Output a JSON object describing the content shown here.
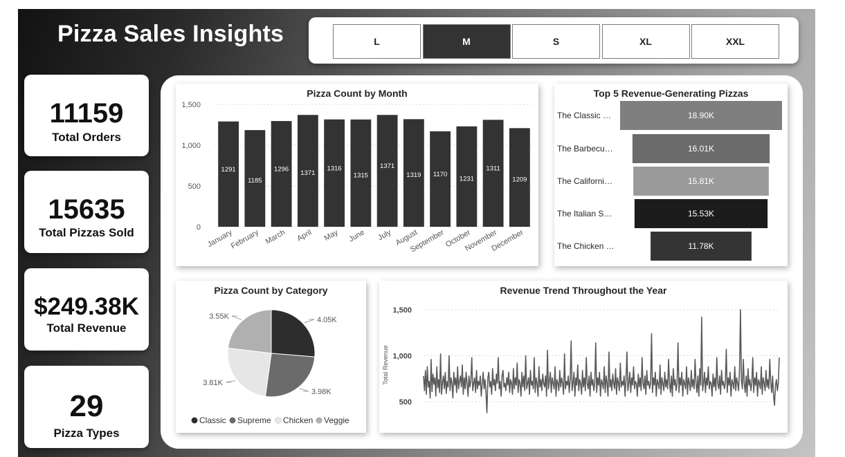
{
  "title": "Pizza Sales Insights",
  "size_filter": {
    "options": [
      "L",
      "M",
      "S",
      "XL",
      "XXL"
    ],
    "selected": "M"
  },
  "kpis": [
    {
      "value": "11159",
      "label": "Total Orders"
    },
    {
      "value": "15635",
      "label": "Total Pizzas Sold"
    },
    {
      "value": "$249.38K",
      "label": "Total Revenue"
    },
    {
      "value": "29",
      "label": "Pizza Types"
    }
  ],
  "colors": {
    "bar": "#333333",
    "top5": [
      "#7f7f7f",
      "#6b6b6b",
      "#9a9a9a",
      "#1c1c1c",
      "#343434"
    ],
    "pie": [
      "#2d2d2d",
      "#6b6b6b",
      "#e6e6e6",
      "#b0b0b0"
    ],
    "line": "#5a5a5a"
  },
  "chart_data": [
    {
      "type": "bar",
      "title": "Pizza Count by Month",
      "categories": [
        "January",
        "February",
        "March",
        "April",
        "May",
        "June",
        "July",
        "August",
        "September",
        "October",
        "November",
        "December"
      ],
      "values": [
        1291,
        1185,
        1296,
        1371,
        1316,
        1315,
        1371,
        1319,
        1170,
        1231,
        1311,
        1209
      ],
      "y_ticks": [
        "0",
        "500",
        "1,000",
        "1,500"
      ],
      "ylim": [
        0,
        1500
      ],
      "grid": true
    },
    {
      "type": "bar",
      "orientation": "horizontal-funnel",
      "title": "Top 5 Revenue-Generating Pizzas",
      "categories": [
        "The Classic …",
        "The Barbecu…",
        "The Californi…",
        "The Italian S…",
        "The Chicken …"
      ],
      "values": [
        18.9,
        16.01,
        15.81,
        15.53,
        11.78
      ],
      "value_labels": [
        "18.90K",
        "16.01K",
        "15.81K",
        "15.53K",
        "11.78K"
      ]
    },
    {
      "type": "pie",
      "title": "Pizza Count by Category",
      "categories": [
        "Classic",
        "Supreme",
        "Chicken",
        "Veggie"
      ],
      "values": [
        4.05,
        3.98,
        3.81,
        3.55
      ],
      "value_labels": [
        "4.05K",
        "3.98K",
        "3.81K",
        "3.55K"
      ],
      "legend": "bottom"
    },
    {
      "type": "line",
      "title": "Revenue Trend Throughout the Year",
      "ylabel": "Total Revenue",
      "y_ticks": [
        "500",
        "1,000",
        "1,500"
      ],
      "ylim": [
        400,
        1600
      ],
      "grid": true,
      "values": [
        780,
        620,
        840,
        580,
        880,
        660,
        720,
        540,
        960,
        610,
        800,
        690,
        760,
        560,
        880,
        650,
        740,
        600,
        1020,
        580,
        700,
        780,
        640,
        820,
        590,
        720,
        660,
        1000,
        620,
        760,
        700,
        540,
        820,
        680,
        760,
        600,
        880,
        640,
        720,
        780,
        660,
        900,
        580,
        760,
        640,
        820,
        700,
        560,
        780,
        660,
        720,
        980,
        620,
        700,
        760,
        600,
        840,
        640,
        720,
        680,
        780,
        560,
        700,
        820,
        640,
        740,
        600,
        380,
        760,
        820,
        660,
        720,
        580,
        860,
        680,
        740,
        620,
        800,
        700,
        980,
        640,
        720,
        560,
        780,
        840,
        660,
        700,
        620,
        760,
        680,
        820,
        600,
        740,
        700,
        580,
        860,
        640,
        760,
        680,
        920,
        600,
        740,
        700,
        560,
        820,
        660,
        780,
        620,
        1000,
        640,
        700,
        760,
        580,
        840,
        680,
        720,
        640,
        980,
        600,
        760,
        700,
        560,
        880,
        660,
        740,
        620,
        800,
        700,
        660,
        780,
        560,
        1060,
        640,
        720,
        820,
        600,
        760,
        700,
        640,
        880,
        560,
        740,
        700,
        620,
        840,
        660,
        760,
        700,
        580,
        1020,
        640,
        720,
        680,
        780,
        600,
        740,
        1160,
        620,
        700,
        820,
        560,
        760,
        680,
        900,
        620,
        740,
        700,
        580,
        840,
        660,
        760,
        620,
        980,
        700,
        640,
        780,
        560,
        820,
        680,
        740,
        620,
        700,
        1140,
        600,
        760,
        680,
        820,
        560,
        740,
        700,
        640,
        880,
        600,
        780,
        700,
        560,
        1040,
        660,
        740,
        620,
        800,
        700,
        640,
        860,
        580,
        760,
        700,
        620,
        920,
        660,
        720,
        680,
        780,
        560,
        740,
        1040,
        620,
        700,
        820,
        600,
        760,
        680,
        880,
        640,
        720,
        700,
        560,
        800,
        660,
        760,
        620,
        980,
        700,
        640,
        780,
        580,
        840,
        680,
        720,
        640,
        700,
        1240,
        600,
        760,
        680,
        820,
        560,
        740,
        700,
        640,
        900,
        580,
        760,
        700,
        620,
        820,
        660,
        740,
        640,
        960,
        700,
        600,
        780,
        560,
        860,
        680,
        740,
        620,
        700,
        1140,
        600,
        760,
        680,
        820,
        560,
        740,
        700,
        640,
        880,
        580,
        760,
        700,
        620,
        840,
        660,
        740,
        640,
        960,
        700,
        600,
        780,
        560,
        860,
        680,
        1420,
        620,
        700,
        820,
        600,
        760,
        680,
        880,
        640,
        720,
        700,
        560,
        800,
        660,
        760,
        620,
        980,
        700,
        640,
        780,
        580,
        840,
        680,
        720,
        640,
        700,
        1070,
        600,
        760,
        680,
        820,
        560,
        740,
        700,
        640,
        880,
        620,
        760,
        700,
        620,
        840,
        1500,
        740,
        640,
        960,
        700,
        600,
        780,
        560,
        860,
        680,
        740,
        620,
        700,
        980,
        600,
        760,
        680,
        820,
        560,
        740,
        700,
        640,
        880,
        580,
        760,
        700,
        620,
        840,
        660,
        740,
        640,
        960,
        700,
        600,
        780,
        560,
        460,
        680,
        740,
        620,
        700,
        980
      ]
    }
  ]
}
